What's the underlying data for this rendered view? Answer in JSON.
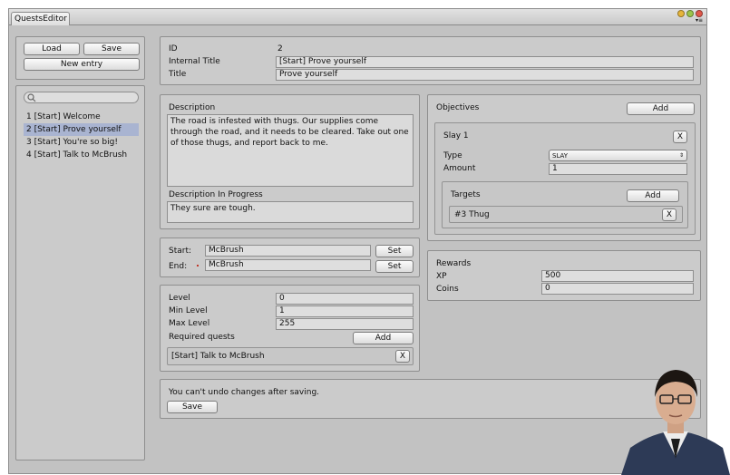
{
  "window": {
    "tab_title": "QuestsEditor"
  },
  "toolbar": {
    "load": "Load",
    "save": "Save",
    "new_entry": "New entry"
  },
  "quest_list": {
    "items": [
      "1 [Start] Welcome",
      "2 [Start] Prove yourself",
      "3 [Start] You're so big!",
      "4 [Start] Talk to McBrush"
    ],
    "selected_index": 1
  },
  "header": {
    "id_label": "ID",
    "id_value": "2",
    "internal_title_label": "Internal Title",
    "internal_title_value": "[Start] Prove yourself",
    "title_label": "Title",
    "title_value": "Prove yourself"
  },
  "description": {
    "label": "Description",
    "text": "The road is infested with thugs. Our supplies come through the road, and it needs to be cleared. Take out one of those thugs, and report back to me.",
    "in_progress_label": "Description In Progress",
    "in_progress_text": "They sure are tough."
  },
  "npcs": {
    "start_label": "Start:",
    "start_value": "McBrush",
    "start_set": "Set",
    "end_label": "End:",
    "end_value": "McBrush",
    "end_set": "Set"
  },
  "levels": {
    "level_label": "Level",
    "level_value": "0",
    "min_label": "Min Level",
    "min_value": "1",
    "max_label": "Max Level",
    "max_value": "255",
    "required_label": "Required quests",
    "add": "Add",
    "required_items": [
      "[Start] Talk to McBrush"
    ],
    "remove": "X"
  },
  "footer": {
    "warning": "You can't undo changes after saving.",
    "save": "Save"
  },
  "objectives": {
    "label": "Objectives",
    "add": "Add",
    "item_title": "Slay 1",
    "remove": "X",
    "type_label": "Type",
    "type_value": "SLAY",
    "amount_label": "Amount",
    "amount_value": "1",
    "targets_label": "Targets",
    "targets_add": "Add",
    "targets": [
      "#3 Thug"
    ],
    "target_remove": "X"
  },
  "rewards": {
    "label": "Rewards",
    "xp_label": "XP",
    "xp_value": "500",
    "coins_label": "Coins",
    "coins_value": "0"
  },
  "colors": {
    "window_bg": "#c2c2c2",
    "panel_bg": "#cbcbcb",
    "selection": "#a9b4d1"
  }
}
